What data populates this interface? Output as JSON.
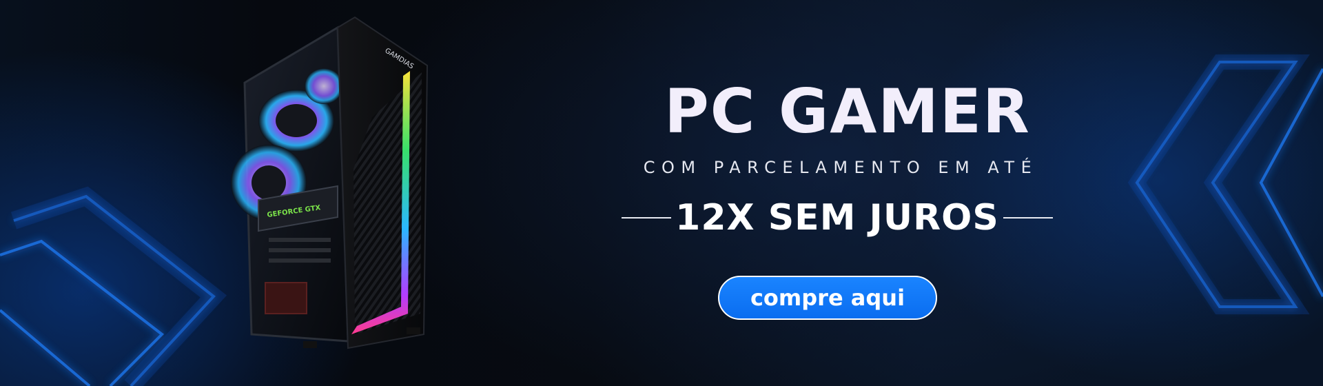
{
  "banner": {
    "title": "PC GAMER",
    "subtitle": "COM PARCELAMENTO EM ATÉ",
    "highlight": "12X SEM JUROS",
    "cta_label": "compre aqui",
    "product_brand": "GAMDIAS",
    "gpu_label": "GEFORCE GTX"
  },
  "colors": {
    "background": "#06090f",
    "accent_blue": "#0a6df0",
    "chevron_glow": "#1d6fe0",
    "text": "#f2eefb"
  },
  "icons": {
    "left_decoration": "chevron-right-icon",
    "right_decoration": "chevron-left-icon"
  }
}
